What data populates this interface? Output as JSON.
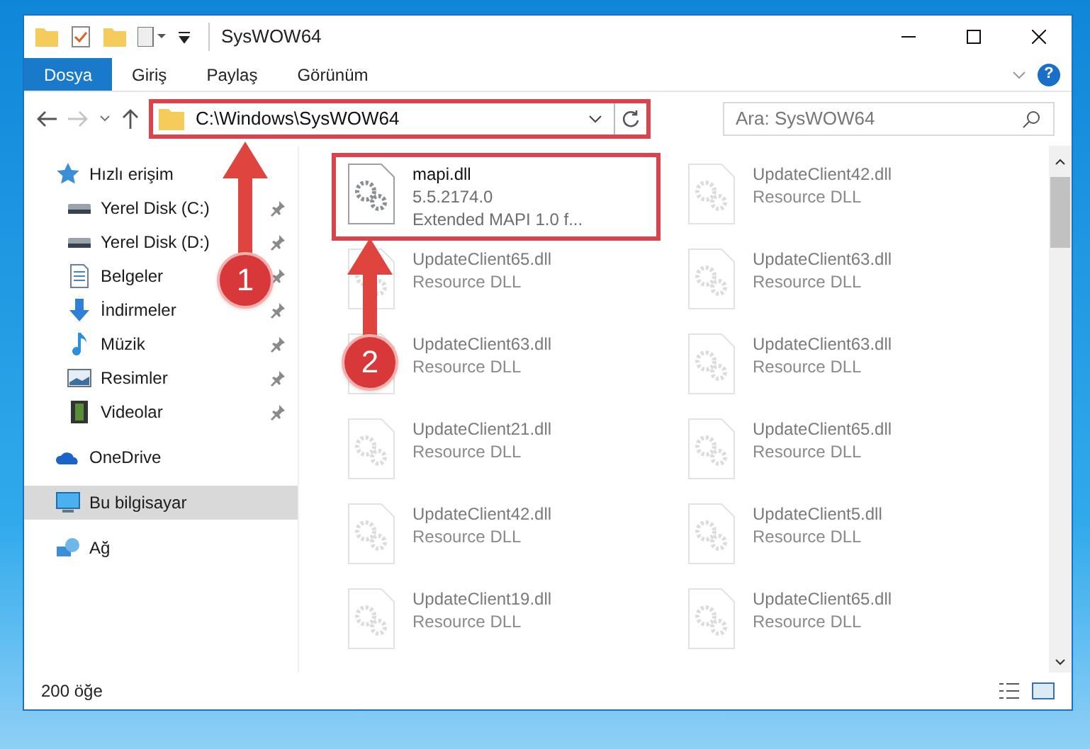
{
  "window": {
    "title": "SysWOW64"
  },
  "ribbon_tabs": [
    {
      "label": "Dosya",
      "selected": true
    },
    {
      "label": "Giriş",
      "selected": false
    },
    {
      "label": "Paylaş",
      "selected": false
    },
    {
      "label": "Görünüm",
      "selected": false
    }
  ],
  "navigation": {
    "back_disabled": false,
    "forward_disabled": true
  },
  "address_bar": {
    "value": "C:\\Windows\\SysWOW64",
    "highlighted": true
  },
  "search": {
    "placeholder": "Ara: SysWOW64"
  },
  "sidebar": {
    "items": [
      {
        "label": "Hızlı erişim",
        "selected": false,
        "children": [
          {
            "label": "Yerel Disk (C:)",
            "pinned": true,
            "selected": false
          },
          {
            "label": "Yerel Disk (D:)",
            "pinned": true,
            "selected": false
          },
          {
            "label": "Belgeler",
            "pinned": true,
            "selected": false
          },
          {
            "label": "İndirmeler",
            "pinned": true,
            "selected": false
          },
          {
            "label": "Müzik",
            "pinned": true,
            "selected": false
          },
          {
            "label": "Resimler",
            "pinned": true,
            "selected": false
          },
          {
            "label": "Videolar",
            "pinned": true,
            "selected": false
          }
        ]
      },
      {
        "label": "OneDrive",
        "selected": false
      },
      {
        "label": "Bu bilgisayar",
        "selected": true
      },
      {
        "label": "Ağ",
        "selected": false
      }
    ]
  },
  "files": [
    {
      "name": "mapi.dll",
      "lines": [
        "5.5.2174.0",
        "Extended MAPI 1.0 f..."
      ],
      "dimmed": false,
      "highlighted": true
    },
    {
      "name": "UpdateClient42.dll",
      "lines": [
        "Resource DLL"
      ],
      "dimmed": true,
      "highlighted": false
    },
    {
      "name": "UpdateClient65.dll",
      "lines": [
        "Resource DLL"
      ],
      "dimmed": true,
      "highlighted": false
    },
    {
      "name": "UpdateClient63.dll",
      "lines": [
        "Resource DLL"
      ],
      "dimmed": true,
      "highlighted": false
    },
    {
      "name": "UpdateClient63.dll",
      "lines": [
        "Resource DLL"
      ],
      "dimmed": true,
      "highlighted": false
    },
    {
      "name": "UpdateClient63.dll",
      "lines": [
        "Resource DLL"
      ],
      "dimmed": true,
      "highlighted": false
    },
    {
      "name": "UpdateClient21.dll",
      "lines": [
        "Resource DLL"
      ],
      "dimmed": true,
      "highlighted": false
    },
    {
      "name": "UpdateClient65.dll",
      "lines": [
        "Resource DLL"
      ],
      "dimmed": true,
      "highlighted": false
    },
    {
      "name": "UpdateClient42.dll",
      "lines": [
        "Resource DLL"
      ],
      "dimmed": true,
      "highlighted": false
    },
    {
      "name": "UpdateClient5.dll",
      "lines": [
        "Resource DLL"
      ],
      "dimmed": true,
      "highlighted": false
    },
    {
      "name": "UpdateClient19.dll",
      "lines": [
        "Resource DLL"
      ],
      "dimmed": true,
      "highlighted": false
    },
    {
      "name": "UpdateClient65.dll",
      "lines": [
        "Resource DLL"
      ],
      "dimmed": true,
      "highlighted": false
    }
  ],
  "help_button": "?",
  "status_bar": {
    "item_count": "200 öğe"
  },
  "annotations": [
    {
      "number": "1"
    },
    {
      "number": "2"
    }
  ]
}
